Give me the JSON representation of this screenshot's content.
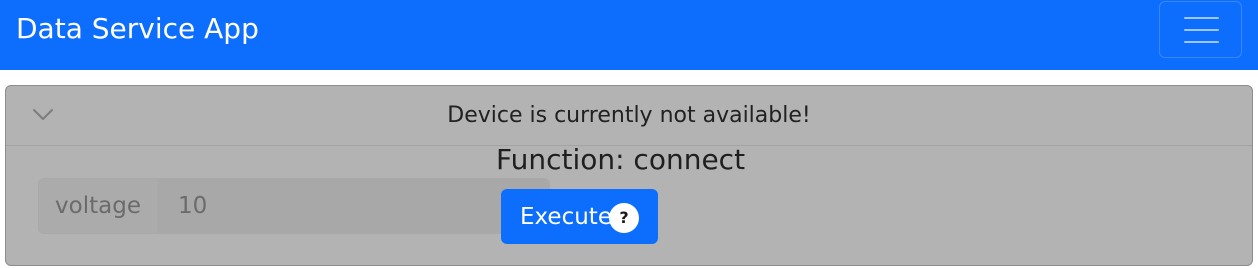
{
  "navbar": {
    "brand": "Data Service App",
    "menu_icon": "hamburger-menu-icon",
    "background": "#0d6efd"
  },
  "device_card": {
    "collapse_icon": "chevron-down-icon",
    "status_message": "Device is currently not available!",
    "parameter": {
      "label": "voltage",
      "value": "10"
    }
  },
  "function_panel": {
    "title": "Function: connect",
    "execute_label": "Execute",
    "help_icon": "question-circle-icon",
    "help_glyph": "?",
    "accent": "#0d6efd"
  }
}
